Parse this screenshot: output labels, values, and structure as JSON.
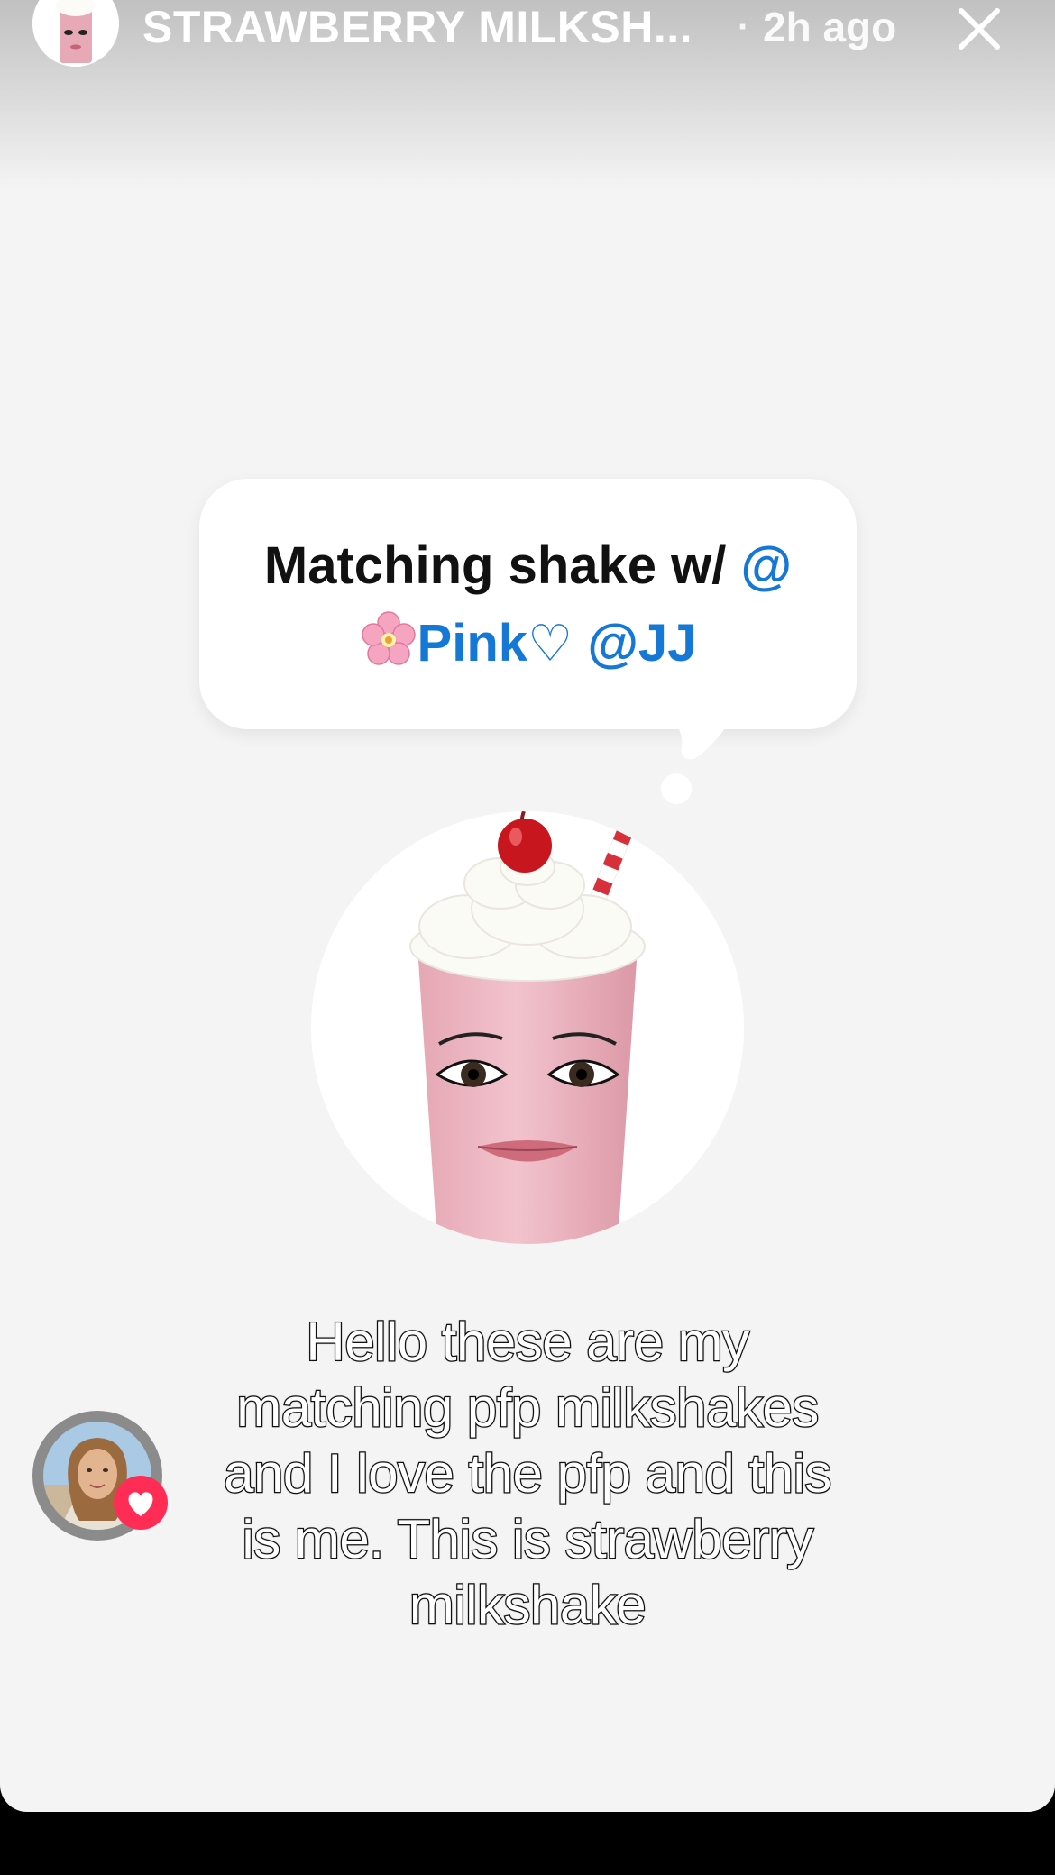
{
  "header": {
    "username": "STRAWBERRY MILKSH...",
    "separator": "·",
    "time_ago": "2h ago"
  },
  "bubble": {
    "prefix": "Matching shake w/ ",
    "mention_1_at": "@",
    "mention_1_name": "Pink",
    "mention_1_heart": "♡",
    "mention_2": "@JJ"
  },
  "caption": {
    "lines": [
      "Hello these are my",
      "matching pfp milkshakes",
      "and I love the pfp and this",
      "is me. This is strawberry",
      "milkshake"
    ]
  },
  "icons": {
    "close": "close-icon",
    "like": "heart-icon",
    "flower": "cherry-blossom-icon"
  },
  "colors": {
    "mention": "#1577d6",
    "like_badge": "#ff2d55",
    "background": "#f4f4f4"
  }
}
